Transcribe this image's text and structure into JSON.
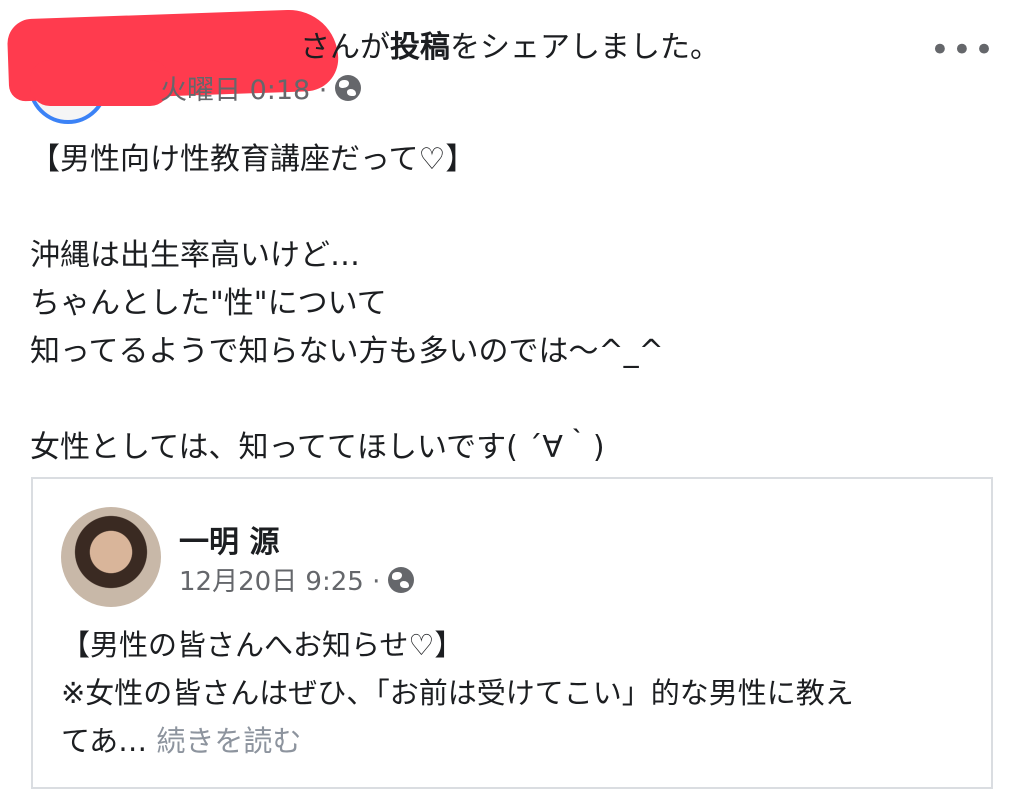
{
  "post": {
    "author_redacted": "",
    "share_suffix_prefix": "さんが",
    "share_suffix_bold": "投稿",
    "share_suffix_rest": "をシェアしました。",
    "timestamp": "火曜日 0:18 ·",
    "more_menu": "•••",
    "text": "【男性向け性教育講座だって♡】\n\n沖縄は出生率高いけど…\nちゃんとした\"性\"について\n知ってるようで知らない方も多いのでは〜^_^\n\n女性としては、知っててほしいです( ´∀｀)"
  },
  "shared": {
    "author": "一明 源",
    "timestamp": "12月20日 9:25 ·",
    "text": "【男性の皆さんへお知らせ♡】\n※女性の皆さんはぜひ、「お前は受けてこい」的な男性に教え\nてあ… ",
    "see_more": "続きを読む"
  },
  "colors": {
    "redaction": "#ff3b4e",
    "secondary_text": "#65676b",
    "border": "#dadde1",
    "see_more": "#8d949e"
  }
}
